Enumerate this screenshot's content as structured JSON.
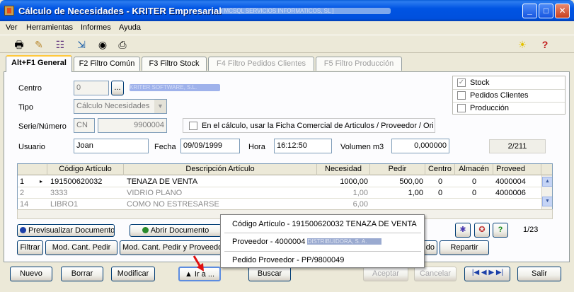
{
  "window": {
    "title": "Cálculo de Necesidades - KRITER Empresarial - ",
    "title_bracket": "[ MCSQL SERVICIOS INFORMATICOS, SL ]",
    "buttons": {
      "minimize": "_",
      "maximize": "□",
      "close": "✕"
    }
  },
  "menu": [
    "Ver",
    "Herramientas",
    "Informes",
    "Ayuda"
  ],
  "toolbar": {
    "icons": [
      "printer-icon",
      "edit-pen-icon",
      "hierarchy-icon",
      "export-icon",
      "view-eye-icon",
      "print-preview-icon"
    ],
    "right_icons": [
      "lightbulb-icon",
      "help-icon"
    ]
  },
  "tabs": [
    {
      "label": "Alt+F1 General",
      "state": "active"
    },
    {
      "label": "F2 Filtro Común",
      "state": "normal"
    },
    {
      "label": "F3 Filtro Stock",
      "state": "normal"
    },
    {
      "label": "F4 Filtro Pedidos Clientes",
      "state": "disabled"
    },
    {
      "label": "F5 Filtro Producción",
      "state": "disabled"
    }
  ],
  "form": {
    "centro_label": "Centro",
    "centro_value": "0",
    "centro_lookup": "...",
    "centro_name": "KRITER SOFTWARE, S.L.",
    "tipo_label": "Tipo",
    "tipo_value": "Cálculo Necesidades",
    "serie_label": "Serie/Número",
    "serie_value": "CN",
    "numero_value": "9900004",
    "ficha_label": "En el cálculo, usar la Ficha Comercial de Articulos / Proveedor / Orige",
    "usuario_label": "Usuario",
    "usuario_value": "Joan",
    "fecha_label": "Fecha",
    "fecha_value": "09/09/1999",
    "hora_label": "Hora",
    "hora_value": "16:12:50",
    "volumen_label": "Volumen m3",
    "volumen_value": "0,000000",
    "record_counter": "2/211"
  },
  "checks": [
    {
      "label": "Stock",
      "checked": true
    },
    {
      "label": "Pedidos Clientes",
      "checked": false
    },
    {
      "label": "Producción",
      "checked": false
    }
  ],
  "grid": {
    "columns": [
      "Código Artículo",
      "Descripción Artículo",
      "Necesidad",
      "Pedir",
      "Centro",
      "Almacén",
      "Proveed"
    ],
    "rows": [
      {
        "num": "1",
        "codigo": "191500620032",
        "descripcion": "TENAZA DE VENTA",
        "necesidad": "1000,00",
        "pedir": "500,00",
        "centro": "0",
        "almacen": "0",
        "proveedor": "4000004"
      },
      {
        "num": "2",
        "codigo": "3333",
        "descripcion": "VIDRIO PLANO",
        "necesidad": "1,00",
        "pedir": "1,00",
        "centro": "0",
        "almacen": "0",
        "proveedor": "4000006"
      },
      {
        "num": "14",
        "codigo": "LIBRO1",
        "descripcion": "COMO NO ESTRESARSE",
        "necesidad": "6,00",
        "pedir": "",
        "centro": "",
        "almacen": "",
        "proveedor": ""
      }
    ],
    "counter": "1/23"
  },
  "action_buttons": {
    "previsualizar": "Previsualizar Documento",
    "abrir": "Abrir Documento",
    "filtrar": "Filtrar",
    "mod_cant": "Mod. Cant. Pedir",
    "mod_cant_prov": "Mod. Cant. Pedir y Proveedor",
    "do_partial": "do",
    "repartir": "Repartir"
  },
  "popup": {
    "items": [
      {
        "text": "Código Artículo - 191500620032 TENAZA DE VENTA"
      },
      {
        "text": "Proveedor - 4000004 ",
        "blurred": "DISTRIBUIDORA, S. A."
      },
      {
        "text": "Pedido Proveedor - PP/9800049"
      }
    ]
  },
  "footer": {
    "nuevo": "Nuevo",
    "borrar": "Borrar",
    "modificar": "Modificar",
    "ira": "▲ Ir a ...",
    "buscar": "Buscar",
    "aceptar": "Aceptar",
    "cancelar": "Cancelar",
    "nav": "|◀ ◀ ▶ ▶|",
    "salir": "Salir"
  }
}
